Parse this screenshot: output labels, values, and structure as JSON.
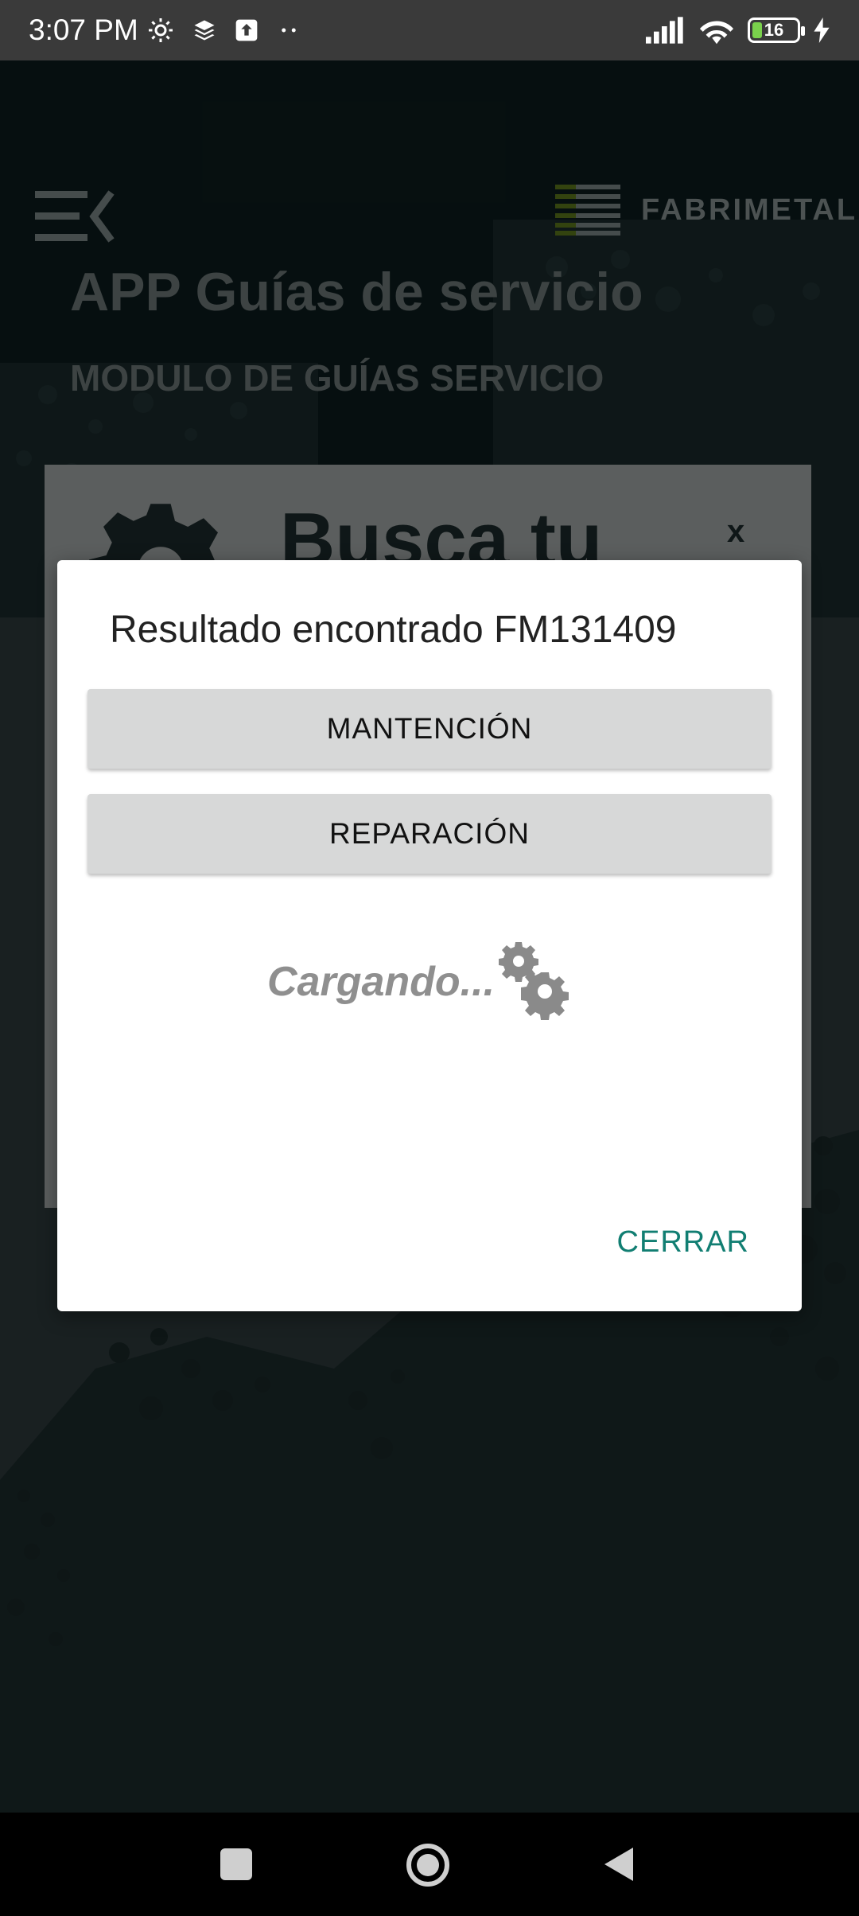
{
  "status_bar": {
    "time": "3:07 PM",
    "battery_level": "16"
  },
  "header": {
    "logo_text": "FABRIMETAL",
    "title": "APP Guías de servicio",
    "subtitle": "MODULO DE GUÍAS SERVICIO"
  },
  "card": {
    "title": "Busca tu",
    "close": "x"
  },
  "dialog": {
    "title": "Resultado encontrado FM131409",
    "buttons": {
      "maintenance": "MANTENCIÓN",
      "repair": "REPARACIÓN"
    },
    "loading_text": "Cargando...",
    "close_label": "CERRAR"
  },
  "colors": {
    "accent": "#117e72",
    "header_bg": "#0c1d1e",
    "logo_green": "#6e8a1f"
  }
}
